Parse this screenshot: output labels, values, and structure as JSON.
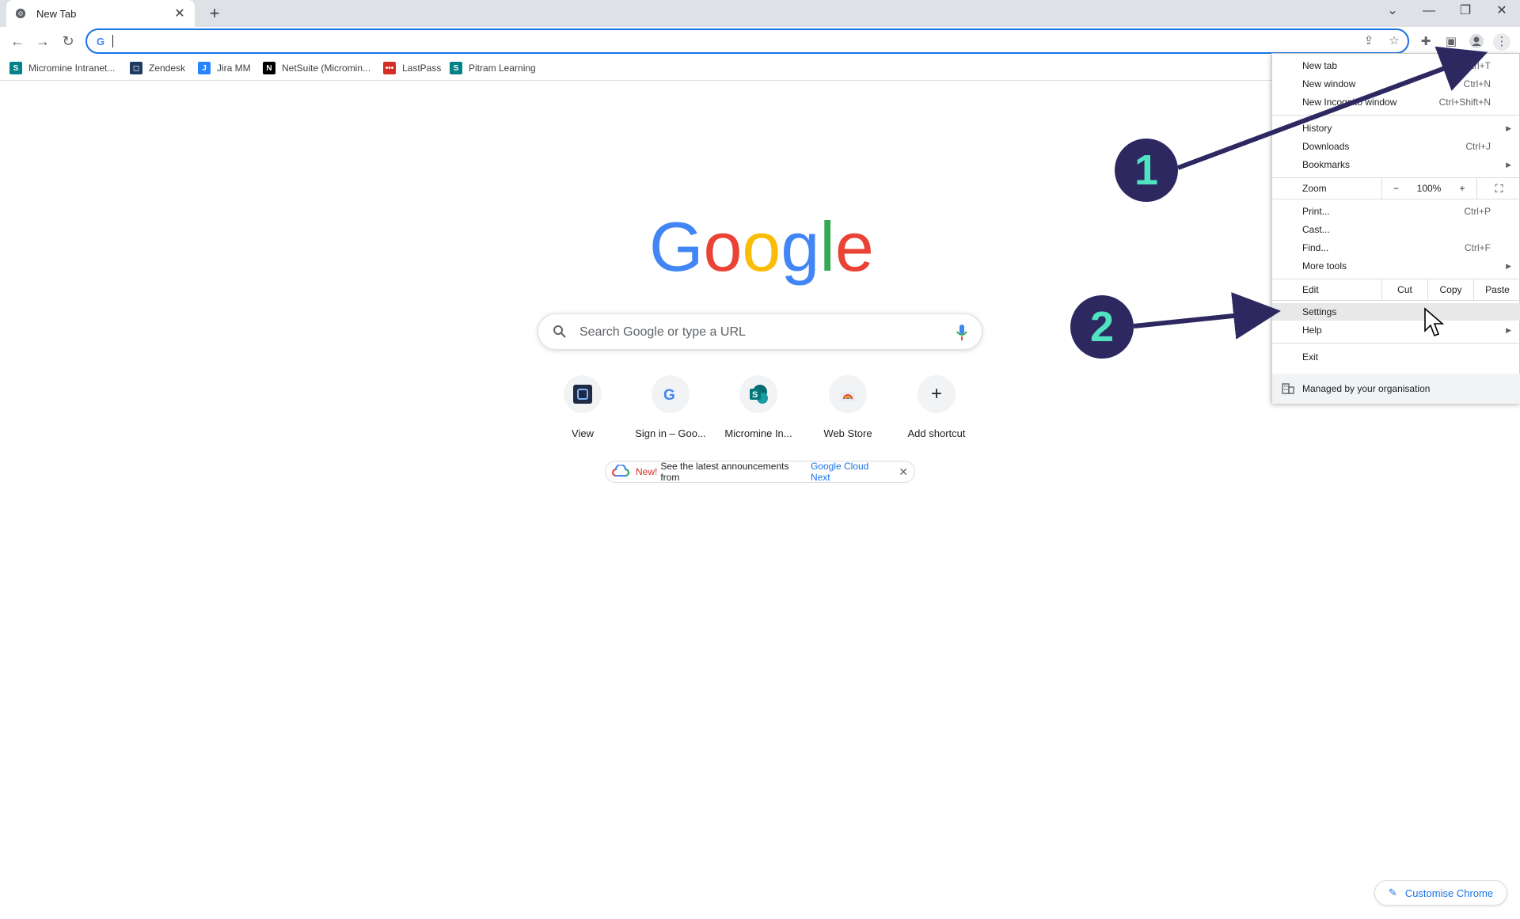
{
  "browser": {
    "tab": {
      "title": "New Tab",
      "icon": "chrome-icon"
    },
    "new_tab_button": "+",
    "window_controls": [
      "chevron-down-icon",
      "minimize-icon",
      "restore-icon",
      "close-icon"
    ]
  },
  "toolbar": {
    "address_value": "",
    "icons": [
      "back-icon",
      "forward-icon",
      "reload-icon",
      "share-icon",
      "star-icon",
      "extensions-icon",
      "side-panel-icon",
      "profile-icon",
      "menu-icon"
    ]
  },
  "bookmarks": [
    {
      "label": "Micromine Intranet...",
      "icon": "sharepoint-icon",
      "color": "#038387"
    },
    {
      "label": "Zendesk",
      "icon": "zendesk-icon",
      "color": "#1f3a5f"
    },
    {
      "label": "Jira MM",
      "icon": "jira-icon",
      "color": "#2684ff"
    },
    {
      "label": "NetSuite (Micromin...",
      "icon": "netsuite-icon",
      "color": "#000000"
    },
    {
      "label": "LastPass",
      "icon": "lastpass-icon",
      "color": "#d32d27"
    },
    {
      "label": "Pitram Learning",
      "icon": "sharepoint-icon",
      "color": "#038387"
    }
  ],
  "ntp": {
    "logo": "Google",
    "search_placeholder": "Search Google or type a URL",
    "shortcuts": [
      {
        "label": "View",
        "icon": "view-app-icon"
      },
      {
        "label": "Sign in – Goo...",
        "icon": "google-g-icon"
      },
      {
        "label": "Micromine In...",
        "icon": "sharepoint-icon"
      },
      {
        "label": "Web Store",
        "icon": "web-store-icon"
      },
      {
        "label": "Add shortcut",
        "icon": "plus-icon"
      }
    ],
    "promo": {
      "new": "New!",
      "text": "See the latest announcements from",
      "link": "Google Cloud Next"
    },
    "customise": "Customise Chrome"
  },
  "menu": {
    "items_top": [
      {
        "label": "New tab",
        "shortcut": "Ctrl+T"
      },
      {
        "label": "New window",
        "shortcut": "Ctrl+N"
      },
      {
        "label": "New Incognito window",
        "shortcut": "Ctrl+Shift+N"
      }
    ],
    "items_mid": [
      {
        "label": "History",
        "shortcut": ""
      },
      {
        "label": "Downloads",
        "shortcut": "Ctrl+J"
      },
      {
        "label": "Bookmarks",
        "shortcut": ""
      }
    ],
    "zoom": {
      "label": "Zoom",
      "minus": "−",
      "value": "100%",
      "plus": "+"
    },
    "items_tools": [
      {
        "label": "Print...",
        "shortcut": "Ctrl+P"
      },
      {
        "label": "Cast...",
        "shortcut": ""
      },
      {
        "label": "Find...",
        "shortcut": "Ctrl+F"
      },
      {
        "label": "More tools",
        "shortcut": ""
      }
    ],
    "edit": {
      "label": "Edit",
      "cut": "Cut",
      "copy": "Copy",
      "paste": "Paste"
    },
    "settings": "Settings",
    "help": "Help",
    "exit": "Exit",
    "managed": "Managed by your organisation"
  },
  "annotations": {
    "step1": "1",
    "step2": "2",
    "color": "#2e2861",
    "number_color": "#4fe3c1"
  }
}
